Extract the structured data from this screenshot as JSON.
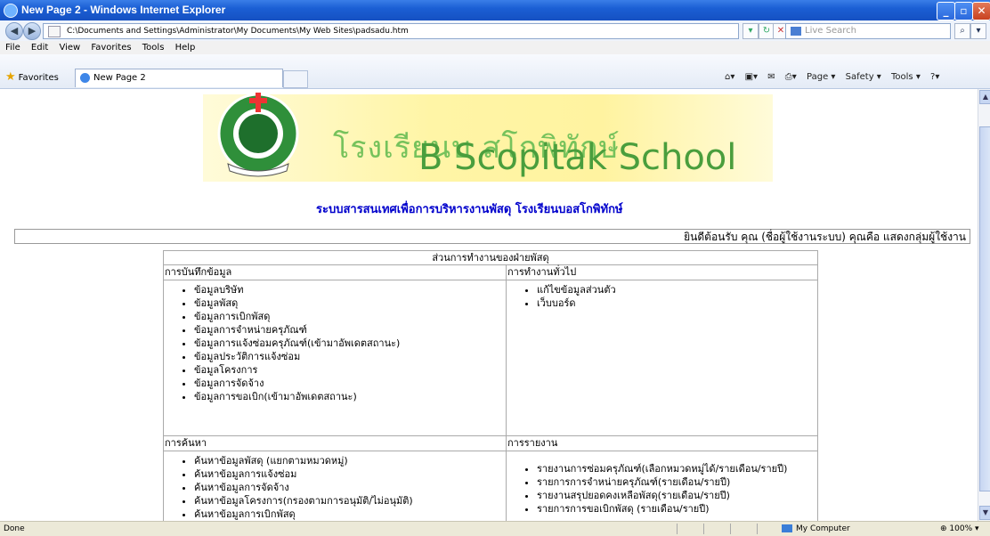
{
  "window": {
    "title": "New Page 2 - Windows Internet Explorer",
    "minimize": "_",
    "maximize": "▫",
    "close": "✕"
  },
  "address": {
    "url": "C:\\Documents and Settings\\Administrator\\My Documents\\My Web Sites\\padsadu.htm",
    "search_placeholder": "Live Search"
  },
  "menu": [
    "File",
    "Edit",
    "View",
    "Favorites",
    "Tools",
    "Help"
  ],
  "favorites": {
    "label": "Favorites",
    "tab_label": "New Page 2",
    "commands": [
      "Page ▾",
      "Safety ▾",
      "Tools ▾"
    ]
  },
  "page": {
    "school_thai": "โรงเรียนบ  สโกพิทักษ์",
    "school_english": "B  Scopitak School",
    "system_title": "ระบบสารสนเทศเพื่อการบริหารงานพัสดุ โรงเรียนบอสโกพิทักษ์",
    "welcome": "ยินดีต้อนรับ คุณ (ชื่อผู้ใช้งานระบบ) คุณคือ แสดงกลุ่มผู้ใช้งาน",
    "table_header": "ส่วนการทำงานของฝ่ายพัสดุ",
    "sections": {
      "data_entry": {
        "title": "การบันทึกข้อมูล",
        "items": [
          "ข้อมูลบริษัท",
          "ข้อมูลพัสดุ",
          "ข้อมูลการเบิกพัสดุ",
          "ข้อมูลการจำหน่ายครุภัณฑ์",
          "ข้อมูลการแจ้งซ่อมครุภัณฑ์(เข้ามาอัพเดตสถานะ)",
          "ข้อมูลประวัติการแจ้งซ่อม",
          "ข้อมูลโครงการ",
          "ข้อมูลการจัดจ้าง",
          "ข้อมูลการขอเบิก(เข้ามาอัพเดตสถานะ)"
        ]
      },
      "general": {
        "title": "การทำงานทั่วไป",
        "items": [
          "แก้ไขข้อมูลส่วนตัว",
          "เว็บบอร์ด"
        ]
      },
      "search": {
        "title": "การค้นหา",
        "items": [
          "ค้นหาข้อมูลพัสดุ (แยกตามหมวดหมู่)",
          "ค้นหาข้อมูลการแจ้งซ่อม",
          "ค้นหาข้อมูลการจัดจ้าง",
          "ค้นหาข้อมูลโครงการ(กรองตามการอนุมัติ/ไม่อนุมัติ)",
          "ค้นหาข้อมูลการเบิกพัสดุ"
        ]
      },
      "reports": {
        "title": "การรายงาน",
        "items": [
          "รายงานการซ่อมครุภัณฑ์(เลือกหมวดหมู่ได้/รายเดือน/รายปี)",
          "รายการการจำหน่ายครุภัณฑ์(รายเดือน/รายปี)",
          "รายงานสรุปยอดคงเหลือพัสดุ(รายเดือน/รายปี)",
          "รายการการขอเบิกพัสดุ (รายเดือน/รายปี)"
        ]
      }
    }
  },
  "status": {
    "left": "Done",
    "zone": "My Computer",
    "zoom": "100%"
  }
}
